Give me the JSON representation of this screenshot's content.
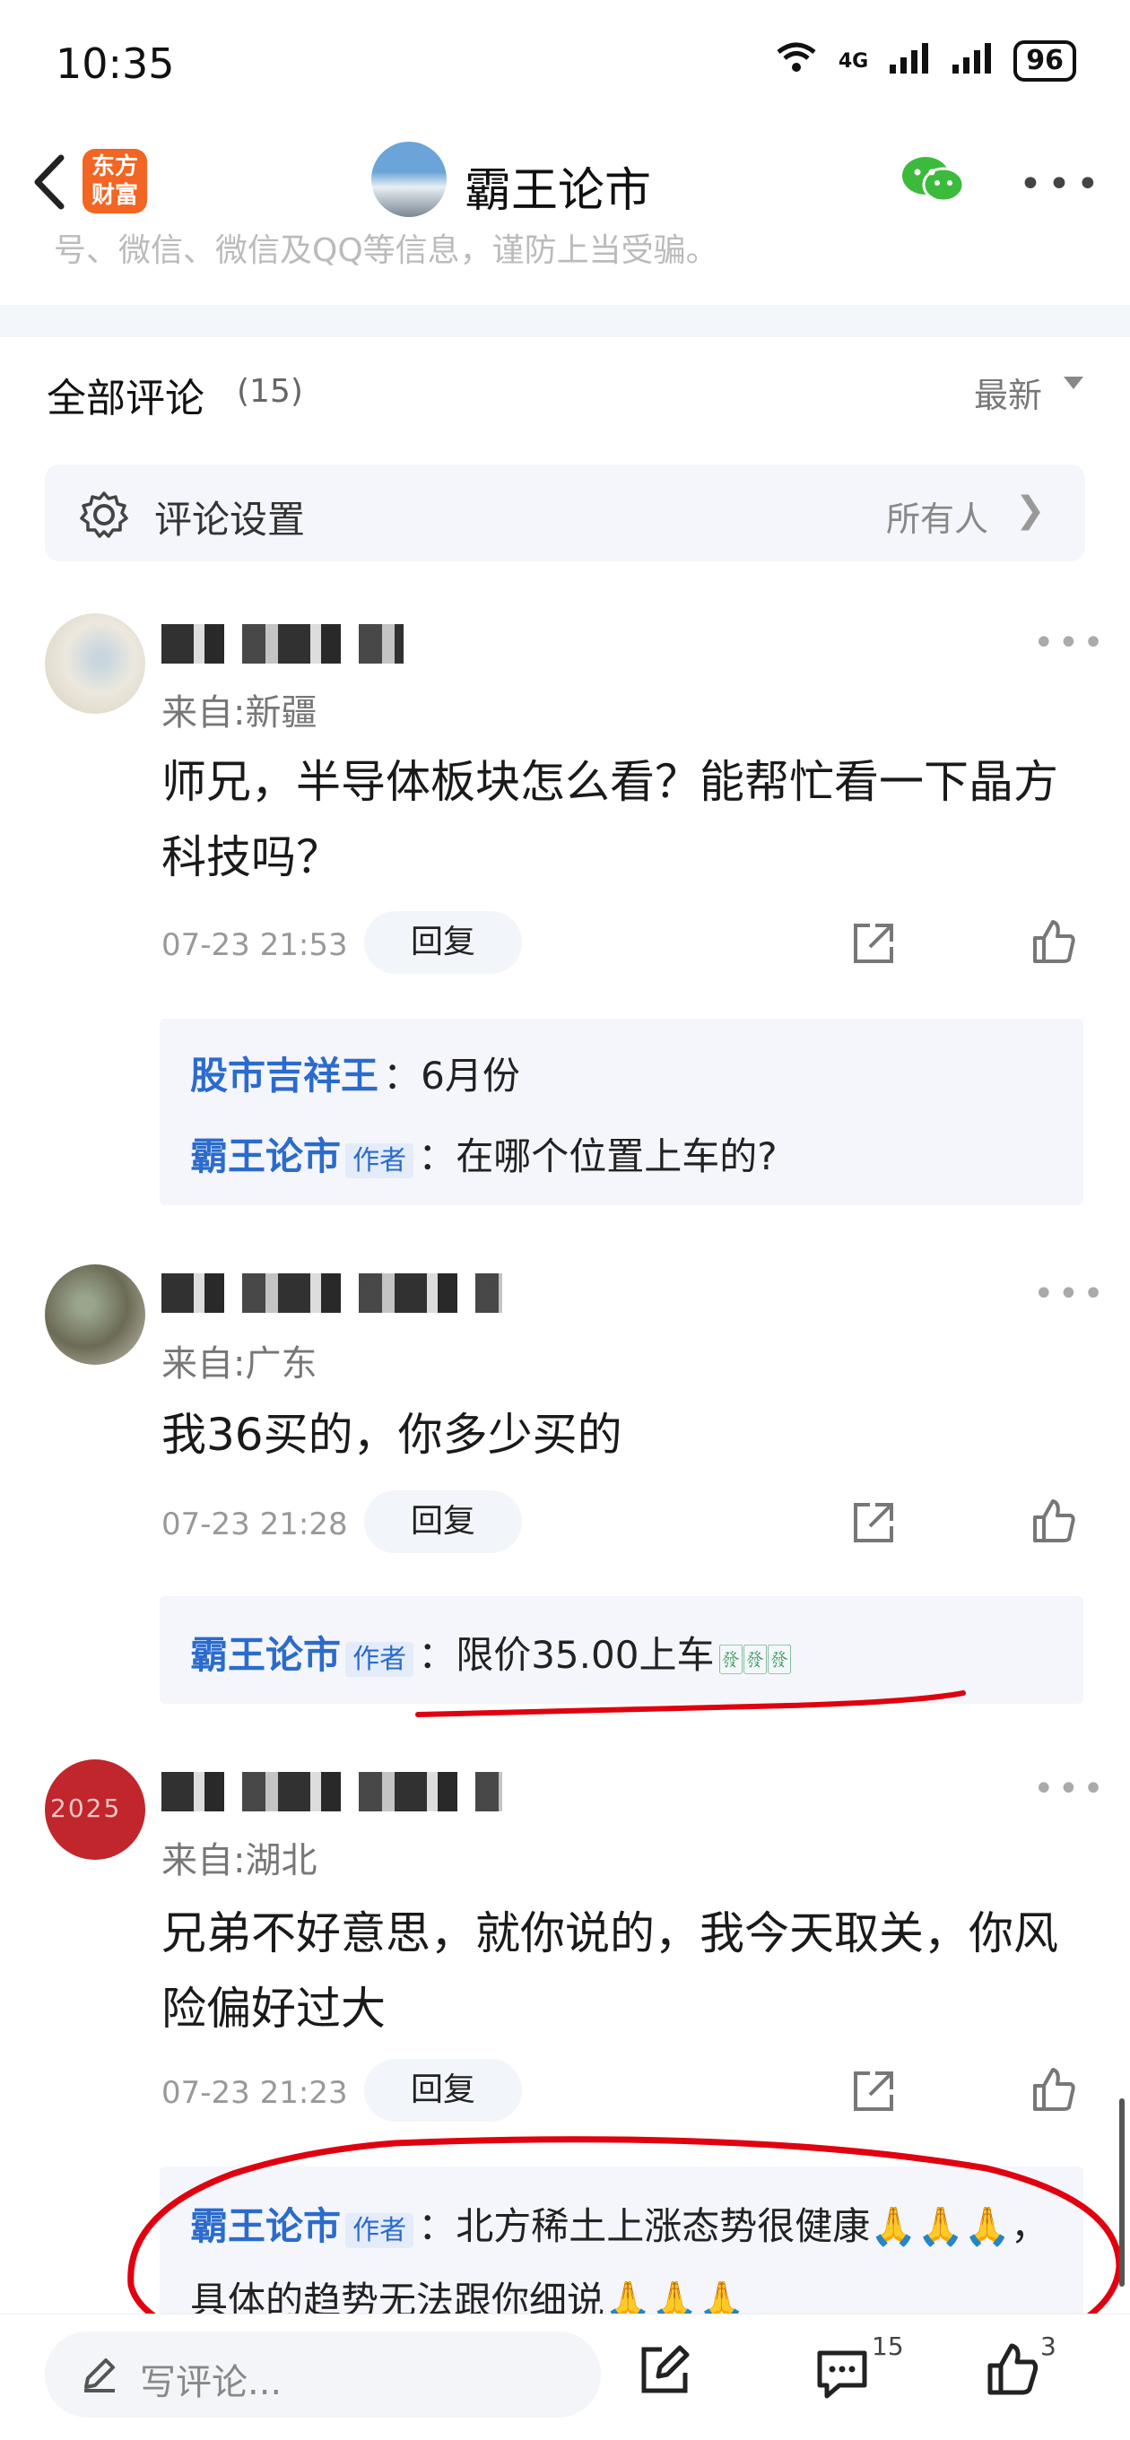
{
  "status_bar": {
    "time": "10:35",
    "network": "4G",
    "battery": "96"
  },
  "nav": {
    "app_badge": "东方\n财富",
    "title": "霸王论市"
  },
  "cut_text": "号、微信、微信及QQ等信息，谨防上当受骗。",
  "comments_header": {
    "title": "全部评论",
    "count": "(15)",
    "sort": "最新"
  },
  "settings": {
    "label": "评论设置",
    "value": "所有人"
  },
  "comments": [
    {
      "location": "来自:新疆",
      "text": "师兄，半导体板块怎么看？能帮忙看一下晶方科技吗？",
      "time": "07-23 21:53",
      "reply_label": "回复",
      "replies": [
        {
          "name": "股市吉祥王",
          "author": false,
          "text": "：6月份"
        },
        {
          "name": "霸王论市",
          "author": true,
          "tag": "作者",
          "text": "：在哪个位置上车的?"
        }
      ]
    },
    {
      "location": "来自:广东",
      "text": "我36买的，你多少买的",
      "time": "07-23 21:28",
      "reply_label": "回复",
      "replies": [
        {
          "name": "霸王论市",
          "author": true,
          "tag": "作者",
          "text": "：限价35.00上车",
          "emoji": "🀅🀅🀅"
        }
      ]
    },
    {
      "location": "来自:湖北",
      "avatar_text": "2025",
      "text": "兄弟不好意思，就你说的，我今天取关，你风险偏好过大",
      "time": "07-23 21:23",
      "reply_label": "回复",
      "replies": [
        {
          "name": "霸王论市",
          "author": true,
          "tag": "作者",
          "text": "：北方稀土上涨态势很健康🙏🙏🙏，具体的趋势无法跟你细说🙏🙏🙏"
        }
      ]
    }
  ],
  "bottom_bar": {
    "input_placeholder": "写评论...",
    "comment_count": "15",
    "like_count": "3"
  },
  "colors": {
    "accent_blue": "#2b6bcc",
    "annotation_red": "#e0000f",
    "brand_orange": "#f26522"
  }
}
